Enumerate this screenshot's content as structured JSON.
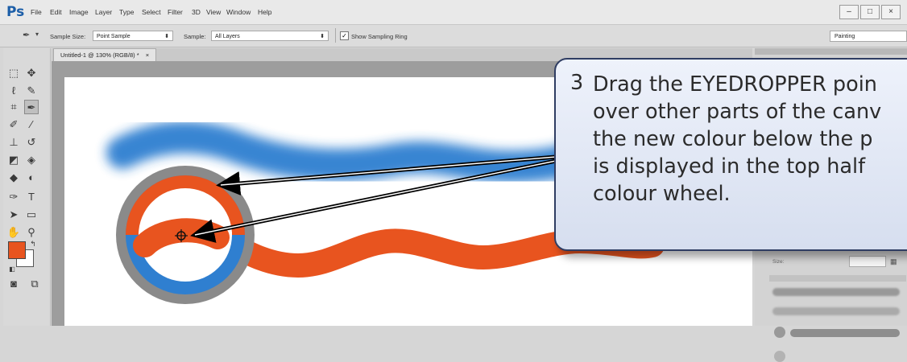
{
  "app": {
    "logo": "Ps",
    "menu": [
      "File",
      "Edit",
      "Image",
      "Layer",
      "Type",
      "Select",
      "Filter",
      "3D",
      "View",
      "Window",
      "Help"
    ],
    "window_controls": [
      "–",
      "□",
      "×"
    ]
  },
  "options_bar": {
    "sample_size_label": "Sample Size:",
    "sample_size_value": "Point Sample",
    "sample_label": "Sample:",
    "sample_value": "All Layers",
    "show_sampling_ring": "Show Sampling Ring",
    "show_sampling_ring_checked": true,
    "workspace_value": "Painting"
  },
  "document": {
    "tab_title": "Untitled-1 @ 130% (RGB/8) *",
    "tab_close": "×"
  },
  "right_panel": {
    "size_label": "Size:"
  },
  "callout": {
    "number": "3",
    "text": "Drag the EYEDROPPER poin\nover other parts of the canv\nthe new colour below the p\nis displayed in the top half\ncolour wheel."
  },
  "colors": {
    "foreground": "#e8541f",
    "background": "#ffffff",
    "blue_stroke": "#2f7fd0",
    "orange_stroke": "#e8541f",
    "callout_border": "#2f3d62"
  },
  "icons": {
    "tools": [
      "marquee-icon",
      "move-icon",
      "lasso-icon",
      "quick-select-icon",
      "crop-icon",
      "eyedropper-icon",
      "healing-brush-icon",
      "brush-icon",
      "clone-stamp-icon",
      "history-brush-icon",
      "eraser-icon",
      "paint-bucket-icon",
      "blur-icon",
      "dodge-icon",
      "pen-icon",
      "type-icon",
      "path-select-icon",
      "shape-icon",
      "hand-icon",
      "zoom-icon",
      "quick-mask-icon",
      "screen-mode-icon"
    ]
  }
}
